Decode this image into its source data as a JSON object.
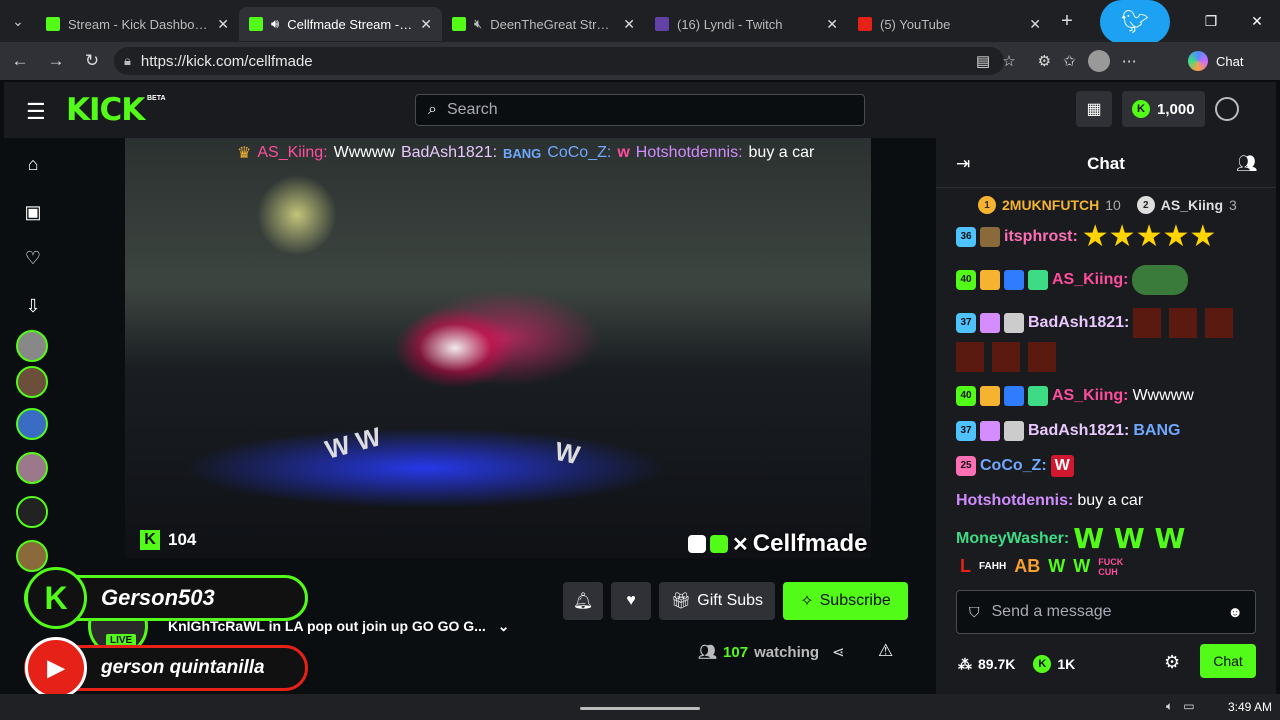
{
  "browser": {
    "tabs": [
      {
        "label": "Stream - Kick Dashboard",
        "favicon": "kick"
      },
      {
        "label": "Cellfmade Stream - Wa",
        "favicon": "kick",
        "active": true
      },
      {
        "label": "DeenTheGreat Stream -",
        "favicon": "kick"
      },
      {
        "label": "(16) Lyndi - Twitch",
        "favicon": "twitch"
      },
      {
        "label": "(5) YouTube",
        "favicon": "youtube"
      }
    ],
    "url": "https://kick.com/cellfmade",
    "copilot_label": "Chat"
  },
  "kick": {
    "logo": "KICK",
    "beta": "BETA",
    "search_placeholder": "Search",
    "kicks_balance": "1,000",
    "accent": "#53fc18"
  },
  "player": {
    "chat_overlay": {
      "user1": "AS_Kiing:",
      "msg1": "Wwwww",
      "user2": "BadAsh1821:",
      "msg2": "BANG",
      "user3": "CoCo_Z:",
      "user4": "Hotshotdennis:",
      "msg4": "buy a car"
    },
    "viewer_count": "104",
    "brand": "Cellfmade"
  },
  "stream": {
    "title": "KnIGhTcRaWL in LA pop out join up GO GO G...",
    "live_label": "LIVE",
    "gift_subs": "Gift Subs",
    "subscribe": "Subscribe",
    "watching_count": "107",
    "watching_label": "watching"
  },
  "banners": {
    "kick_name": "Gerson503",
    "youtube_name": "gerson quintanilla"
  },
  "chat": {
    "title": "Chat",
    "pinned": [
      {
        "rank": "1",
        "name": "2MUKNFUTCH",
        "count": "10"
      },
      {
        "rank": "2",
        "name": "AS_Kiing",
        "count": "3"
      }
    ],
    "messages": [
      {
        "badge": "36",
        "user": "itsphrost:",
        "text": ""
      },
      {
        "badge": "40",
        "user": "AS_Kiing:",
        "text": ""
      },
      {
        "badge": "37",
        "user": "BadAsh1821:",
        "text": ""
      },
      {
        "badge": "40",
        "user": "AS_Kiing:",
        "text": "Wwwww"
      },
      {
        "badge": "37",
        "user": "BadAsh1821:",
        "text": "BANG"
      },
      {
        "badge": "25",
        "user": "CoCo_Z:",
        "text": "W"
      },
      {
        "badge": "",
        "user": "Hotshotdennis:",
        "text": "buy a car"
      },
      {
        "badge": "",
        "user": "MoneyWasher:",
        "text": "W W W"
      }
    ],
    "emote_row": [
      "L",
      "FAHH",
      "AB",
      "W",
      "W",
      "FUCK CUH"
    ],
    "input_placeholder": "Send a message",
    "followers": "89.7K",
    "kicks": "1K",
    "send_label": "Chat"
  },
  "taskbar": {
    "time": "3:49 AM"
  }
}
